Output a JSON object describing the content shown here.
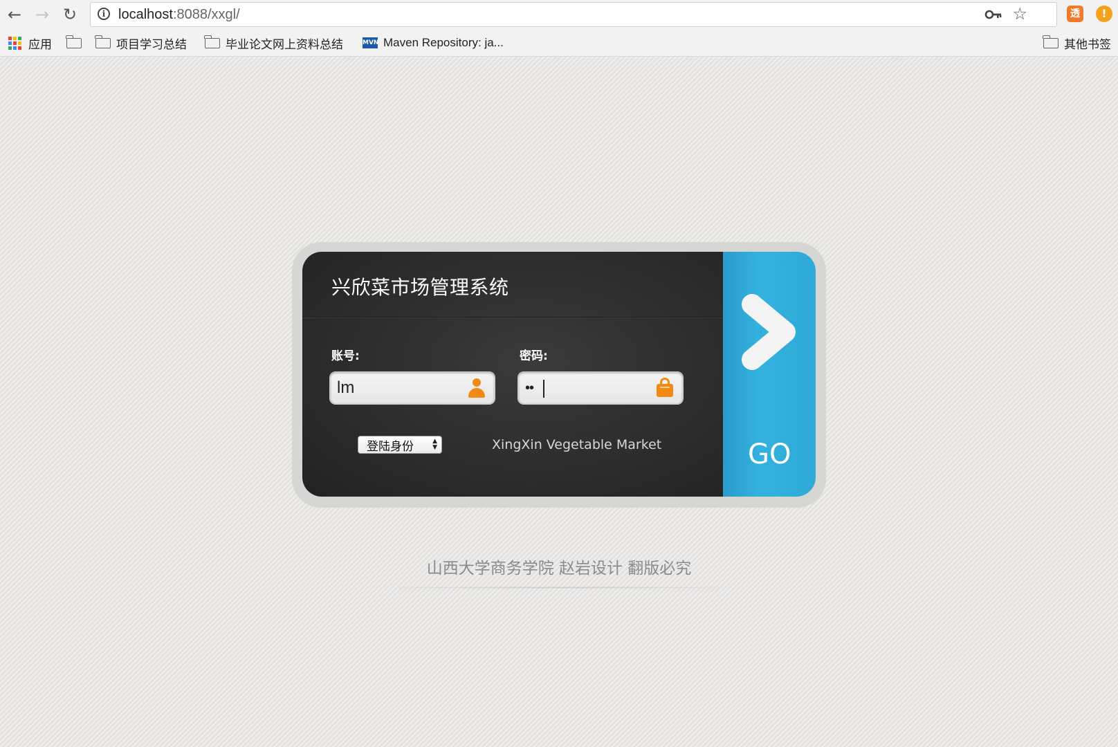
{
  "browser": {
    "url_host": "localhost",
    "url_rest": ":8088/xxgl/",
    "bookmarks": [
      {
        "label": "应用",
        "icon": "apps-icon"
      },
      {
        "label": "",
        "icon": "folder-icon"
      },
      {
        "label": "项目学习总结",
        "icon": "folder-icon"
      },
      {
        "label": "毕业论文网上资料总结",
        "icon": "folder-icon"
      },
      {
        "label": "Maven Repository: ja...",
        "icon": "mvn-icon"
      }
    ],
    "other_bookmarks": "其他书签",
    "mvn_icon_text": "MVN",
    "ext1_text": "透",
    "ext2_text": "!"
  },
  "login": {
    "title": "兴欣菜市场管理系统",
    "account_label": "账号:",
    "account_value": "lm",
    "password_label": "密码:",
    "password_value": "••",
    "role_select": "登陆身份",
    "market_text": "XingXin Vegetable Market",
    "go_label": "GO"
  },
  "footer": {
    "text": "山西大学商务学院 赵岩设计 翻版必究"
  },
  "colors": {
    "accent_blue": "#2fa9d8",
    "icon_orange": "#f08a14",
    "panel_dark": "#2d2d2d"
  }
}
